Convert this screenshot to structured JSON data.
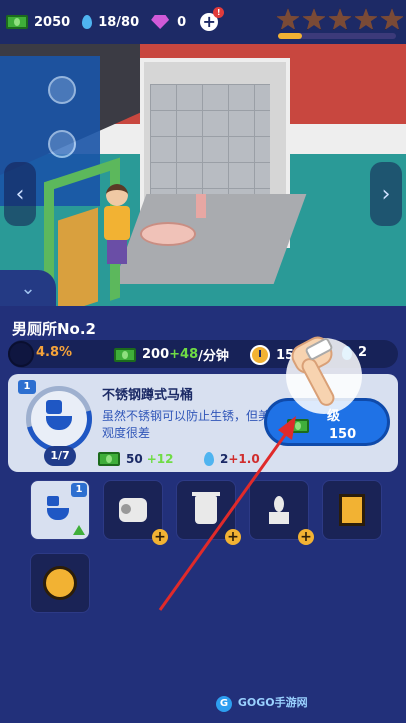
{
  "hud": {
    "cash": "2050",
    "water": "18/80",
    "gems": "0",
    "add_label": "+",
    "alert": "!",
    "stars_total": 5,
    "star_progress": 0.2
  },
  "scene": {
    "left_arrow": "‹",
    "right_arrow": "›",
    "collapse": "⌄"
  },
  "panel": {
    "title": "男厕所No.2",
    "stats": {
      "satisfaction": "4.8%",
      "income_base": "200",
      "income_bonus": "+48",
      "income_unit": "/分钟",
      "time": "15",
      "water": "2"
    },
    "upgrade_card": {
      "badge": "1",
      "level": "1/7",
      "level_fraction": 0.14,
      "name": "不锈钢蹲式马桶",
      "description": "虽然不锈钢可以防止生锈，但美观度很差",
      "reward_cash": "50",
      "reward_cash_bonus": "+12",
      "reward_water": "2",
      "reward_water_bonus": "+1.0",
      "button_label": "级",
      "button_cost": "150"
    },
    "slots": [
      {
        "name": "toilet",
        "badge": "1",
        "icon": "toilet-icon"
      },
      {
        "name": "toilet-paper",
        "icon": "toilet-paper-icon",
        "plus": "+"
      },
      {
        "name": "trash-bin",
        "icon": "trash-bin-icon",
        "plus": "+"
      },
      {
        "name": "plant",
        "icon": "plant-icon",
        "plus": "+"
      },
      {
        "name": "picture",
        "icon": "picture-frame-icon"
      },
      {
        "name": "fan",
        "icon": "fan-icon"
      }
    ]
  },
  "watermark": {
    "logo": "G",
    "text": "GOGO手游网"
  },
  "colors": {
    "panel": "#22307a",
    "accent_blue": "#1f72e6",
    "green": "#6fdc45",
    "orange": "#f5a33a",
    "red_arrow": "#e02a2a"
  }
}
